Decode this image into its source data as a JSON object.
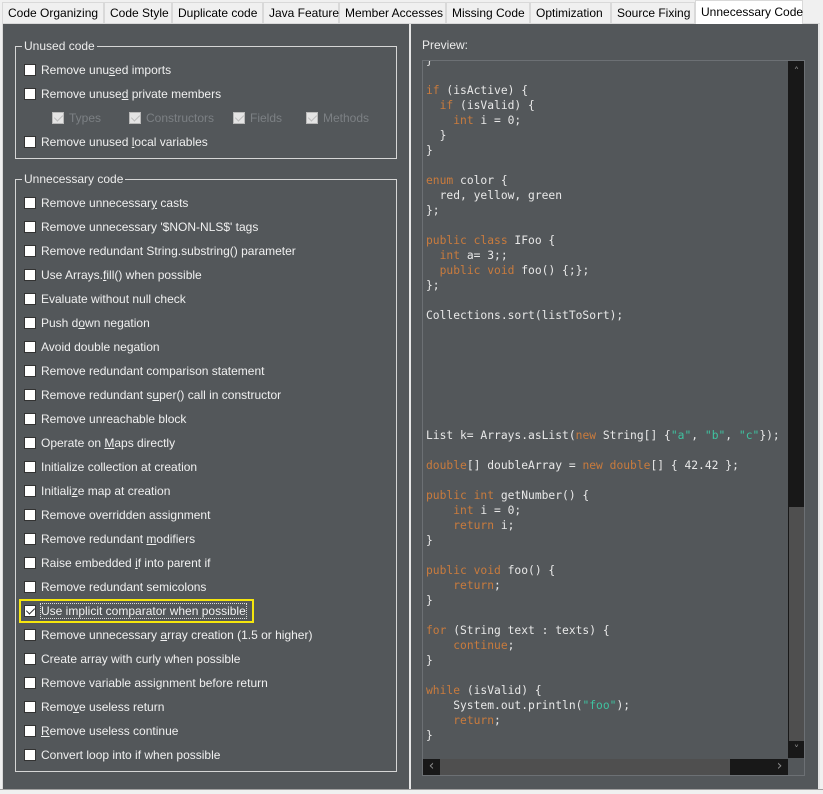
{
  "tabs": [
    {
      "label": "Code Organizing",
      "active": false
    },
    {
      "label": "Code Style",
      "active": false
    },
    {
      "label": "Duplicate code",
      "active": false
    },
    {
      "label": "Java Feature",
      "active": false
    },
    {
      "label": "Member Accesses",
      "active": false
    },
    {
      "label": "Missing Code",
      "active": false
    },
    {
      "label": "Optimization",
      "active": false
    },
    {
      "label": "Source Fixing",
      "active": false
    },
    {
      "label": "Unnecessary Code",
      "active": true
    }
  ],
  "unused_code": {
    "title": "Unused code",
    "remove_unused_imports": {
      "pre": "Remove unu",
      "mn": "s",
      "post": "ed imports",
      "checked": false
    },
    "remove_unused_private_members": {
      "pre": "Remove unuse",
      "mn": "d",
      "post": " private members",
      "checked": false
    },
    "sub_options": [
      {
        "label": "Types",
        "checked": true,
        "disabled": true
      },
      {
        "label": "Constructors",
        "checked": true,
        "disabled": true
      },
      {
        "label": "Fields",
        "checked": true,
        "disabled": true
      },
      {
        "label": "Methods",
        "checked": true,
        "disabled": true
      }
    ],
    "remove_unused_local_variables": {
      "pre": "Remove unused ",
      "mn": "l",
      "post": "ocal variables",
      "checked": false
    }
  },
  "unnecessary_code": {
    "title": "Unnecessary code",
    "options": [
      {
        "pre": "Remove unnecessar",
        "mn": "y",
        "post": " casts",
        "checked": false
      },
      {
        "pre": "Remove unnecessary '$NON-NLS$' ta",
        "mn": "g",
        "post": "s",
        "checked": false
      },
      {
        "pre": "Remove redundant String.substring() parameter",
        "mn": "",
        "post": "",
        "checked": false
      },
      {
        "pre": "Use Arrays.",
        "mn": "f",
        "post": "ill() when possible",
        "checked": false
      },
      {
        "pre": "Evaluate without null check",
        "mn": "",
        "post": "",
        "checked": false
      },
      {
        "pre": "Push d",
        "mn": "o",
        "post": "wn negation",
        "checked": false
      },
      {
        "pre": "Avoid double negation",
        "mn": "",
        "post": "",
        "checked": false
      },
      {
        "pre": "Remove redundant comparison statement",
        "mn": "",
        "post": "",
        "checked": false
      },
      {
        "pre": "Remove redundant s",
        "mn": "u",
        "post": "per() call in constructor",
        "checked": false
      },
      {
        "pre": "Remove unreachable block",
        "mn": "",
        "post": "",
        "checked": false
      },
      {
        "pre": "Operate on ",
        "mn": "M",
        "post": "aps directly",
        "checked": false
      },
      {
        "pre": "Initialize collection at creation",
        "mn": "",
        "post": "",
        "checked": false
      },
      {
        "pre": "Initiali",
        "mn": "z",
        "post": "e map at creation",
        "checked": false
      },
      {
        "pre": "Remove overridden assignment",
        "mn": "",
        "post": "",
        "checked": false
      },
      {
        "pre": "Remove redundant ",
        "mn": "m",
        "post": "odifiers",
        "checked": false
      },
      {
        "pre": "Raise embedded ",
        "mn": "i",
        "post": "f into parent if",
        "checked": false
      },
      {
        "pre": "Remove redundant semicolons",
        "mn": "",
        "post": "",
        "checked": false
      },
      {
        "pre": "Use implicit comparator when possible",
        "mn": "",
        "post": "",
        "checked": true,
        "focused": true,
        "highlighted": true
      },
      {
        "pre": "Remove unnecessary ",
        "mn": "a",
        "post": "rray creation (1.5 or higher)",
        "checked": false
      },
      {
        "pre": "Create array with curly when possible",
        "mn": "",
        "post": "",
        "checked": false
      },
      {
        "pre": "Remove variable assignment before return",
        "mn": "",
        "post": "",
        "checked": false
      },
      {
        "pre": "Remo",
        "mn": "v",
        "post": "e useless return",
        "checked": false
      },
      {
        "pre": "",
        "mn": "R",
        "post": "emove useless continue",
        "checked": false
      },
      {
        "pre": "Convert loop into if when possible",
        "mn": "",
        "post": "",
        "checked": false
      }
    ]
  },
  "preview": {
    "label": "Preview:",
    "lines": [
      [
        [
          "t",
          "}"
        ]
      ],
      [],
      [
        [
          "k",
          "if"
        ],
        [
          "t",
          " (isActive) {"
        ]
      ],
      [
        [
          "t",
          "  "
        ],
        [
          "k",
          "if"
        ],
        [
          "t",
          " (isValid) {"
        ]
      ],
      [
        [
          "t",
          "    "
        ],
        [
          "k",
          "int"
        ],
        [
          "t",
          " i = 0;"
        ]
      ],
      [
        [
          "t",
          "  }"
        ]
      ],
      [
        [
          "t",
          "}"
        ]
      ],
      [],
      [
        [
          "k",
          "enum"
        ],
        [
          "t",
          " color {"
        ]
      ],
      [
        [
          "t",
          "  red, yellow, green"
        ]
      ],
      [
        [
          "t",
          "};"
        ]
      ],
      [],
      [
        [
          "k",
          "public class"
        ],
        [
          "t",
          " IFoo {"
        ]
      ],
      [
        [
          "t",
          "  "
        ],
        [
          "k",
          "int"
        ],
        [
          "t",
          " a= 3;;"
        ]
      ],
      [
        [
          "t",
          "  "
        ],
        [
          "k",
          "public void"
        ],
        [
          "t",
          " foo() {;};"
        ]
      ],
      [
        [
          "t",
          "};"
        ]
      ],
      [],
      [
        [
          "t",
          "Collections.sort(listToSort);"
        ]
      ],
      [],
      [],
      [],
      [],
      [],
      [],
      [],
      [
        [
          "t",
          "List k= Arrays.asList("
        ],
        [
          "k",
          "new"
        ],
        [
          "t",
          " String[] {"
        ],
        [
          "s",
          "\"a\""
        ],
        [
          "t",
          ", "
        ],
        [
          "s",
          "\"b\""
        ],
        [
          "t",
          ", "
        ],
        [
          "s",
          "\"c\""
        ],
        [
          "t",
          "});"
        ]
      ],
      [],
      [
        [
          "k",
          "double"
        ],
        [
          "t",
          "[] doubleArray = "
        ],
        [
          "k",
          "new double"
        ],
        [
          "t",
          "[] { 42.42 };"
        ]
      ],
      [],
      [
        [
          "k",
          "public int"
        ],
        [
          "t",
          " getNumber() {"
        ]
      ],
      [
        [
          "t",
          "    "
        ],
        [
          "k",
          "int"
        ],
        [
          "t",
          " i = 0;"
        ]
      ],
      [
        [
          "t",
          "    "
        ],
        [
          "k",
          "return"
        ],
        [
          "t",
          " i;"
        ]
      ],
      [
        [
          "t",
          "}"
        ]
      ],
      [],
      [
        [
          "k",
          "public void"
        ],
        [
          "t",
          " foo() {"
        ]
      ],
      [
        [
          "t",
          "    "
        ],
        [
          "k",
          "return"
        ],
        [
          "t",
          ";"
        ]
      ],
      [
        [
          "t",
          "}"
        ]
      ],
      [],
      [
        [
          "k",
          "for"
        ],
        [
          "t",
          " (String text : texts) {"
        ]
      ],
      [
        [
          "t",
          "    "
        ],
        [
          "k",
          "continue"
        ],
        [
          "t",
          ";"
        ]
      ],
      [
        [
          "t",
          "}"
        ]
      ],
      [],
      [
        [
          "k",
          "while"
        ],
        [
          "t",
          " (isValid) {"
        ]
      ],
      [
        [
          "t",
          "    System.out.println("
        ],
        [
          "s",
          "\"foo\""
        ],
        [
          "t",
          ");"
        ]
      ],
      [
        [
          "t",
          "    "
        ],
        [
          "k",
          "return"
        ],
        [
          "t",
          ";"
        ]
      ],
      [
        [
          "t",
          "}"
        ]
      ]
    ]
  },
  "scrollbars": {
    "up_icon": "˄",
    "down_icon": "˅",
    "left_icon": "‹",
    "right_icon": "›"
  },
  "colors": {
    "keyword": "#c97b3d",
    "string": "#3fc2a0",
    "background": "#53575a",
    "highlight": "#f5e60e"
  }
}
